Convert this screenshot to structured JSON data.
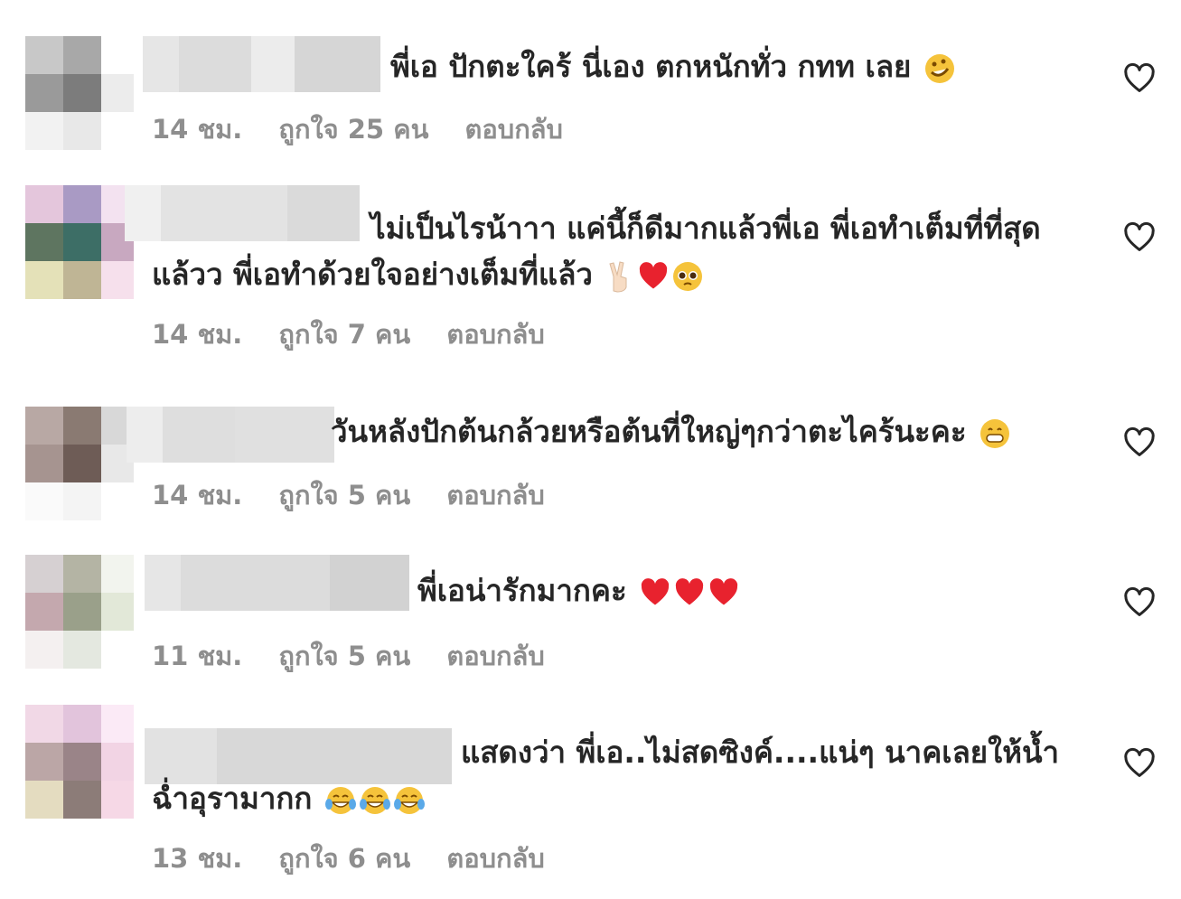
{
  "comments": [
    {
      "text": "พี่เอ ปักตะใคร้ นี่เอง ตกหนักทั่ว กทท เลย",
      "emojis": [
        "rofl-emoji"
      ],
      "time": "14 ชม.",
      "likes": "ถูกใจ 25 คน",
      "reply": "ตอบกลับ"
    },
    {
      "text": "ไม่เป็นไรน้าาา แค่นี้ก็ดีมากแล้วพี่เอ พี่เอทำเต็มที่ที่สุดแล้วว พี่เอทำด้วยใจอย่างเต็มที่แล้ว",
      "emojis": [
        "victory-hand-emoji",
        "red-heart-emoji",
        "pleading-face-emoji"
      ],
      "time": "14 ชม.",
      "likes": "ถูกใจ 7 คน",
      "reply": "ตอบกลับ"
    },
    {
      "text": "วันหลังปักต้นกล้วยหรือต้นที่ใหญ่ๆกว่าตะไคร้นะคะ",
      "emojis": [
        "grinning-face-emoji"
      ],
      "time": "14 ชม.",
      "likes": "ถูกใจ 5 คน",
      "reply": "ตอบกลับ"
    },
    {
      "text": "พี่เอน่ารักมากคะ",
      "emojis": [
        "red-heart-emoji",
        "red-heart-emoji",
        "red-heart-emoji"
      ],
      "time": "11 ชม.",
      "likes": "ถูกใจ 5 คน",
      "reply": "ตอบกลับ"
    },
    {
      "text": "แสดงว่า พี่เอ..ไม่สดซิงค์....แน่ๆ นาคเลยให้น้ำฉ่ำอุรามากก",
      "emojis": [
        "tears-of-joy-emoji",
        "tears-of-joy-emoji",
        "tears-of-joy-emoji"
      ],
      "time": "13 ชม.",
      "likes": "ถูกใจ 6 คน",
      "reply": "ตอบกลับ"
    }
  ]
}
